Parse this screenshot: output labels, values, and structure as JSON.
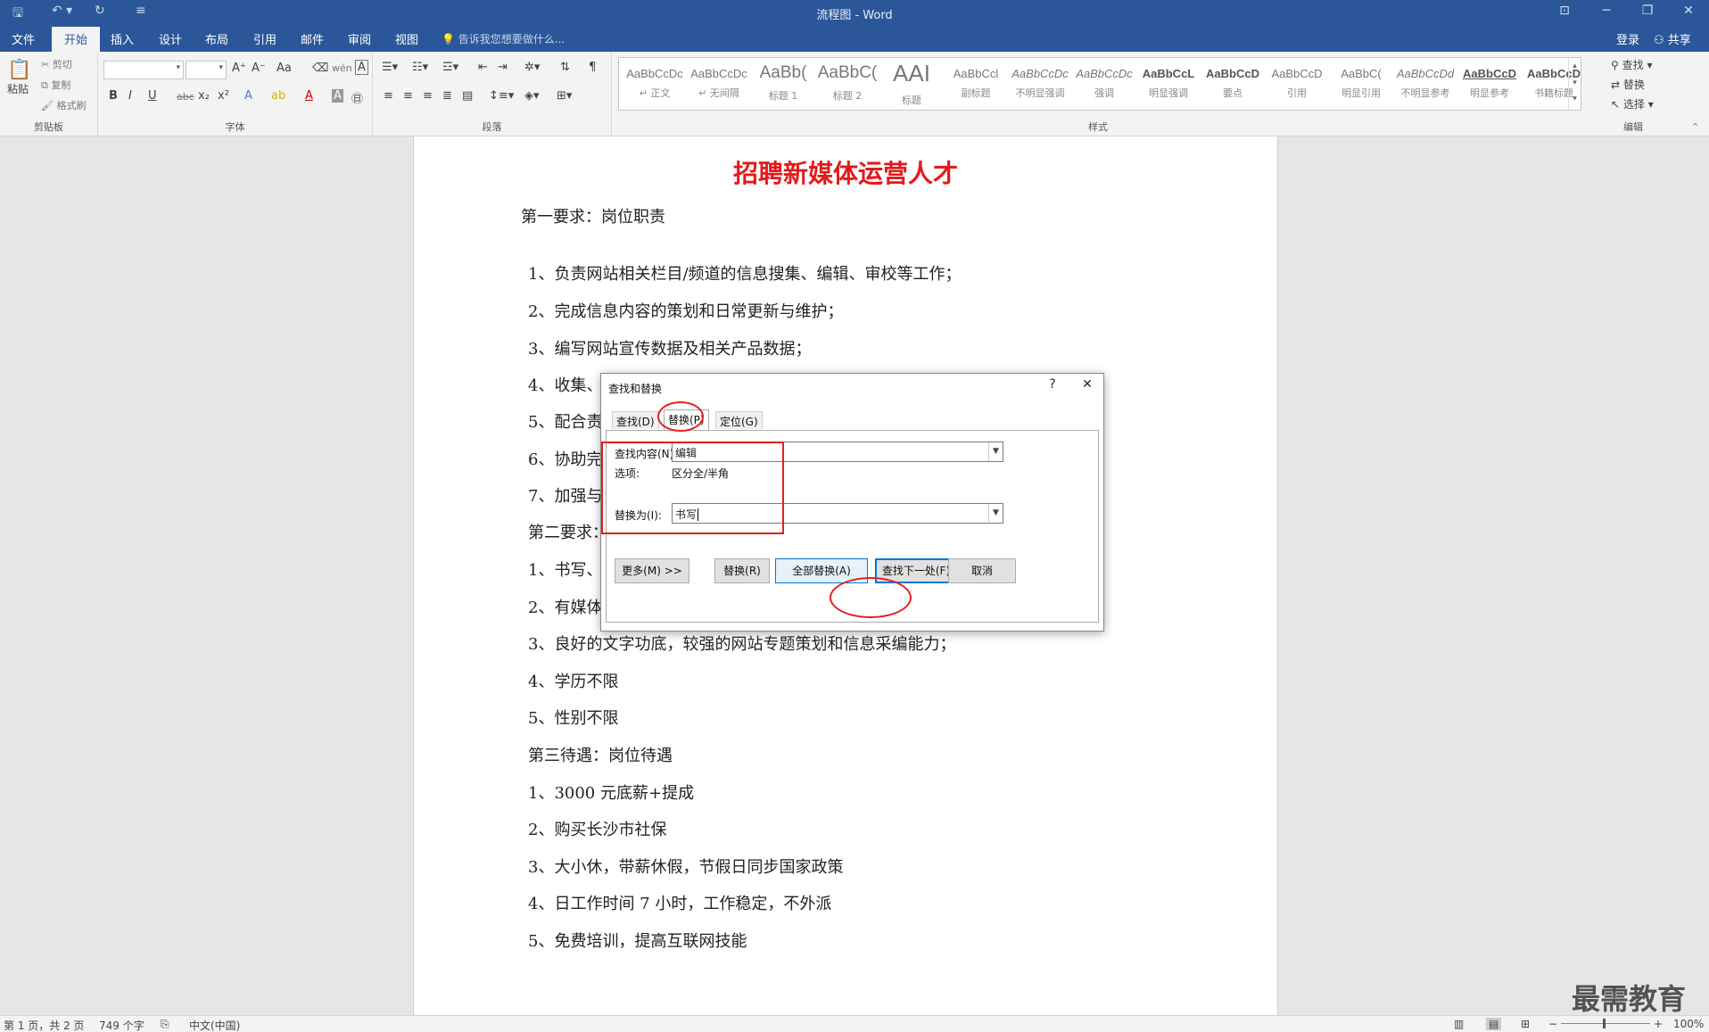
{
  "window": {
    "title": "流程图 - Word",
    "qa_icons": [
      "save-icon",
      "undo-icon",
      "redo-icon",
      "customize-icon"
    ]
  },
  "tabs": [
    "文件",
    "开始",
    "插入",
    "设计",
    "布局",
    "引用",
    "邮件",
    "审阅",
    "视图"
  ],
  "active_tab": "开始",
  "tell_me": "告诉我您想要做什么...",
  "account": {
    "login": "登录",
    "share": "共享"
  },
  "ribbon": {
    "clipboard": {
      "paste": "粘贴",
      "cut": "剪切",
      "copy": "复制",
      "format_painter": "格式刷",
      "label": "剪贴板"
    },
    "font": {
      "label": "字体",
      "bold": "B",
      "italic": "I",
      "underline": "U",
      "strike": "abc",
      "sub": "x₂",
      "sup": "x²",
      "grow": "A⁺",
      "shrink": "A⁻",
      "case": "Aa",
      "font_color": "A",
      "phonetic": "wén"
    },
    "paragraph": {
      "label": "段落"
    },
    "styles": {
      "label": "样式",
      "items": [
        {
          "sample": "AaBbCcDc",
          "name": "↵ 正文"
        },
        {
          "sample": "AaBbCcDc",
          "name": "↵ 无间隔"
        },
        {
          "sample": "AaBb(",
          "name": "标题 1"
        },
        {
          "sample": "AaBbC(",
          "name": "标题 2"
        },
        {
          "sample": "AAI",
          "name": "标题"
        },
        {
          "sample": "AaBbCcl",
          "name": "副标题"
        },
        {
          "sample": "AaBbCcDc",
          "name": "不明显强调"
        },
        {
          "sample": "AaBbCcDc",
          "name": "强调"
        },
        {
          "sample": "AaBbCcL",
          "name": "明显强调"
        },
        {
          "sample": "AaBbCcD",
          "name": "要点"
        },
        {
          "sample": "AaBbCcD",
          "name": "引用"
        },
        {
          "sample": "AaBbC(",
          "name": "明显引用"
        },
        {
          "sample": "AaBbCcDd",
          "name": "不明显参考"
        },
        {
          "sample": "AaBbCcD",
          "name": "明显参考"
        },
        {
          "sample": "AaBbCcD",
          "name": "书籍标题"
        }
      ]
    },
    "editing": {
      "label": "编辑",
      "find": "查找",
      "replace": "替换",
      "select": "选择"
    }
  },
  "document": {
    "title": "招聘新媒体运营人才",
    "lines": [
      "第一要求：岗位职责",
      "1、负责网站相关栏目/频道的信息搜集、编辑、审校等工作；",
      "2、完成信息内容的策划和日常更新与维护；",
      "3、编写网站宣传数据及相关产品数据；",
      "4、收集、",
      "5、配合责",
      "6、协助完",
      "7、加强与",
      "第二要求：",
      "1、书写、",
      "2、有媒体",
      "3、良好的文字功底，较强的网站专题策划和信息采编能力；",
      "4、学历不限",
      "5、性别不限",
      "第三待遇：岗位待遇",
      "1、3000 元底薪+提成",
      "2、购买长沙市社保",
      "3、大小休，带薪休假，节假日同步国家政策",
      "4、日工作时间 7 小时，工作稳定，不外派",
      "5、免费培训，提高互联网技能"
    ]
  },
  "dialog": {
    "title": "查找和替换",
    "help": "?",
    "close": "✕",
    "tabs": [
      "查找(D)",
      "替换(P)",
      "定位(G)"
    ],
    "selected_tab": "替换(P)",
    "find_label": "查找内容(N):",
    "find_value": "编辑",
    "options_label": "选项:",
    "options_value": "区分全/半角",
    "replace_label": "替换为(I):",
    "replace_value": "书写",
    "buttons": {
      "more": "更多(M) >>",
      "replace": "替换(R)",
      "replace_all": "全部替换(A)",
      "find_next": "查找下一处(F)",
      "cancel": "取消"
    }
  },
  "status": {
    "page": "第 1 页，共 2 页",
    "words": "749 个字",
    "language": "中文(中国)",
    "zoom": "100%"
  },
  "watermark": "最需教育",
  "annotation_color": "#e0201f"
}
